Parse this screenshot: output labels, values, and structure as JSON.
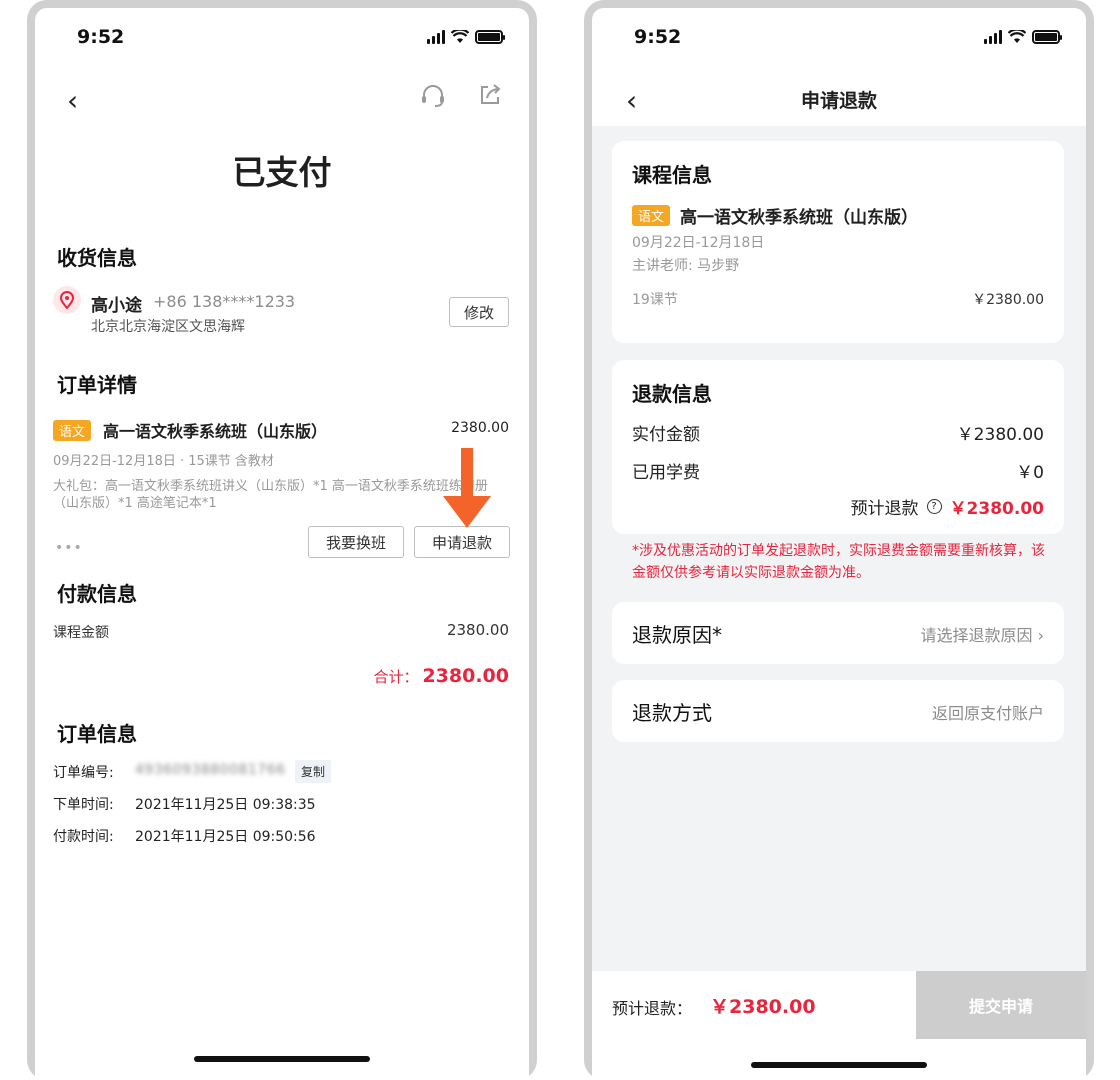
{
  "status": {
    "time": "9:52"
  },
  "left": {
    "title": "已支付",
    "shipping": {
      "heading": "收货信息",
      "name": "高小途",
      "phone": "+86 138****1233",
      "address": "北京北京海淀区文思海辉",
      "edit_label": "修改"
    },
    "order_detail": {
      "heading": "订单详情",
      "tag": "语文",
      "course": "高一语文秋季系统班（山东版）",
      "price": "2380.00",
      "meta": "09月22日-12月18日 · 15课节  含教材",
      "gift": "大礼包：高一语文秋季系统班讲义（山东版）*1  高一语文秋季系统班练习册（山东版）*1  高途笔记本*1",
      "dots": "•••",
      "change_label": "我要换班",
      "refund_label": "申请退款"
    },
    "payment": {
      "heading": "付款信息",
      "course_amount_label": "课程金额",
      "course_amount_value": "2380.00",
      "total_label": "合计：",
      "total_value": "2380.00"
    },
    "order_info": {
      "heading": "订单信息",
      "order_no_label": "订单编号:",
      "order_no_value": "4936093880081766",
      "copy_label": "复制",
      "order_time_label": "下单时间:",
      "order_time_value": "2021年11月25日 09:38:35",
      "pay_time_label": "付款时间:",
      "pay_time_value": "2021年11月25日 09:50:56"
    }
  },
  "right": {
    "title": "申请退款",
    "course_info": {
      "heading": "课程信息",
      "tag": "语文",
      "course": "高一语文秋季系统班（山东版）",
      "date": "09月22日-12月18日",
      "teacher": "主讲老师:   马步野",
      "lessons": "19课节",
      "price": "￥2380.00"
    },
    "refund_info": {
      "heading": "退款信息",
      "paid_label": "实付金额",
      "paid_value": "￥2380.00",
      "used_label": "已用学费",
      "used_value": "￥0",
      "estimate_label": "预计退款",
      "estimate_value": "￥2380.00"
    },
    "notice": "*涉及优惠活动的订单发起退款时，实际退费金额需要重新核算，该金额仅供参考请以实际退款金额为准。",
    "reason": {
      "label": "退款原因*",
      "placeholder": "请选择退款原因"
    },
    "method": {
      "label": "退款方式",
      "value": "返回原支付账户"
    },
    "footer": {
      "estimate_label": "预计退款：",
      "estimate_value": "￥2380.00",
      "submit_label": "提交申请"
    }
  },
  "colors": {
    "accent_red": "#e8253d",
    "tag_orange": "#f5a623",
    "arrow_orange": "#f4632a"
  }
}
